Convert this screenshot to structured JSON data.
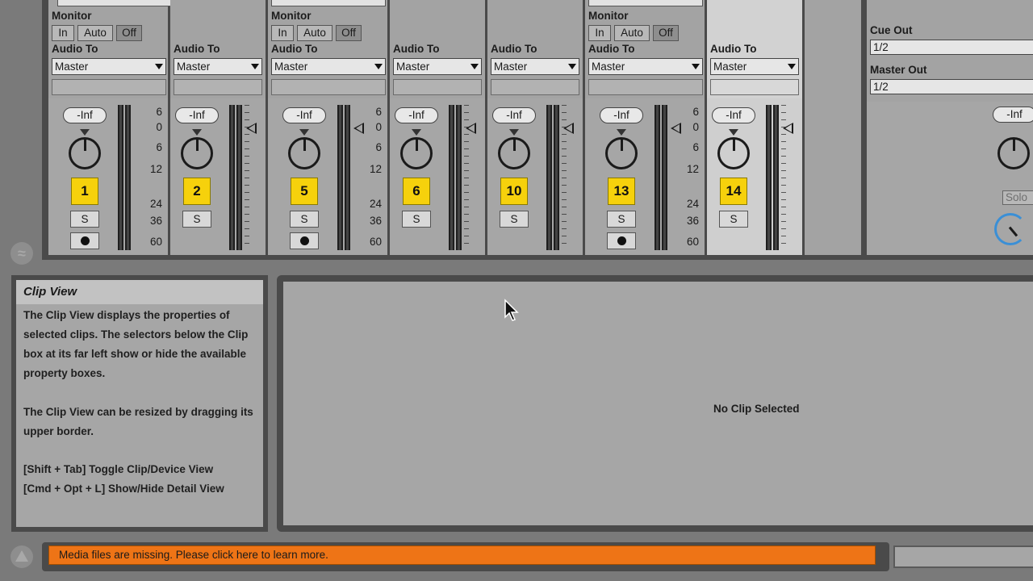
{
  "io": {
    "monitor_label": "Monitor",
    "audio_to_label": "Audio To",
    "monitor_in": "In",
    "monitor_auto": "Auto",
    "monitor_off": "Off",
    "dropdown_value": "Master",
    "top_select_1": "1",
    "top_select_2": "2"
  },
  "tracks": [
    {
      "number": "1",
      "volume": "-Inf",
      "solo": "S"
    },
    {
      "number": "2",
      "volume": "-Inf",
      "solo": "S"
    },
    {
      "number": "5",
      "volume": "-Inf",
      "solo": "S"
    },
    {
      "number": "6",
      "volume": "-Inf",
      "solo": "S"
    },
    {
      "number": "10",
      "volume": "-Inf",
      "solo": "S"
    },
    {
      "number": "13",
      "volume": "-Inf",
      "solo": "S"
    },
    {
      "number": "14",
      "volume": "-Inf",
      "solo": "S"
    }
  ],
  "meter_scale": [
    "6",
    "0",
    "6",
    "12",
    "24",
    "36",
    "60"
  ],
  "master": {
    "cue_out_label": "Cue Out",
    "cue_out_value": "1/2",
    "master_out_label": "Master Out",
    "master_out_value": "1/2",
    "volume": "-Inf",
    "solo": "Solo"
  },
  "info": {
    "title": "Clip View",
    "para1": "The Clip View displays the properties of selected clips. The selectors below the Clip box at its far left show or hide the available property boxes.",
    "para2": "The Clip View can be resized by dragging its upper border.",
    "shortcut1": "[Shift + Tab] Toggle Clip/Device View",
    "shortcut2": "[Cmd + Opt + L] Show/Hide Detail View"
  },
  "clip": {
    "empty_message": "No Clip Selected"
  },
  "status": {
    "message": "Media files are missing. Please click here to learn more."
  },
  "colors": {
    "track_button": "#f6d10c",
    "status_warning": "#ee7416",
    "panel_bg": "#a6a6a6",
    "frame": "#4a4a4a"
  }
}
